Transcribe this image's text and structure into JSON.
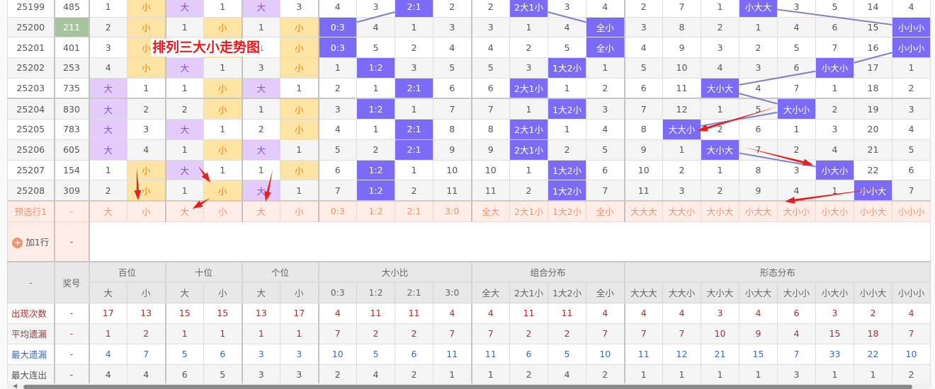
{
  "title": "排列三大小走势图",
  "colors": {
    "purple_hl": "#7b6bf6",
    "big_bg": "#e3ccfb",
    "small_bg": "#fde3a4",
    "line": "#7f7fc8",
    "arrow": "#e5211d"
  },
  "rows": [
    {
      "period": "25199",
      "number": "485",
      "cells": [
        "1",
        "小",
        "大",
        "1",
        "大",
        "3",
        "4",
        "3",
        "2:1",
        "2",
        "2",
        "2大1小",
        "3",
        "4",
        "2",
        "7",
        "1",
        "小大大",
        "3",
        "5",
        "14",
        "4"
      ]
    },
    {
      "period": "25200",
      "number": "211",
      "number_highlight": true,
      "cells": [
        "2",
        "小",
        "1",
        "小",
        "1",
        "小",
        "0:3",
        "4",
        "1",
        "3",
        "3",
        "1",
        "4",
        "全小",
        "3",
        "8",
        "2",
        "1",
        "4",
        "6",
        "15",
        "小小小"
      ]
    },
    {
      "period": "25201",
      "number": "401",
      "cells": [
        "3",
        "小",
        "2",
        "小",
        "1",
        "小",
        "0:3",
        "5",
        "2",
        "4",
        "4",
        "2",
        "5",
        "全小",
        "4",
        "9",
        "3",
        "2",
        "5",
        "7",
        "16",
        "小小小"
      ]
    },
    {
      "period": "25202",
      "number": "253",
      "cells": [
        "4",
        "小",
        "大",
        "1",
        "3",
        "小",
        "1",
        "1:2",
        "3",
        "5",
        "5",
        "3",
        "1大2小",
        "1",
        "5",
        "10",
        "4",
        "3",
        "6",
        "小大小",
        "17",
        "1"
      ]
    },
    {
      "period": "25203",
      "number": "735",
      "cells": [
        "大",
        "1",
        "1",
        "小",
        "大",
        "1",
        "2",
        "1",
        "2:1",
        "6",
        "6",
        "2大1小",
        "1",
        "2",
        "6",
        "11",
        "大小大",
        "4",
        "7",
        "1",
        "18",
        "2"
      ]
    },
    {
      "period": "25204",
      "number": "830",
      "cells": [
        "大",
        "2",
        "2",
        "小",
        "1",
        "小",
        "3",
        "1:2",
        "1",
        "7",
        "7",
        "1",
        "1大2小",
        "3",
        "7",
        "12",
        "1",
        "5",
        "大小小",
        "2",
        "19",
        "3"
      ]
    },
    {
      "period": "25205",
      "number": "783",
      "cells": [
        "大",
        "3",
        "大",
        "1",
        "2",
        "小",
        "4",
        "1",
        "2:1",
        "8",
        "8",
        "2大1小",
        "1",
        "4",
        "8",
        "大大小",
        "2",
        "6",
        "1",
        "3",
        "20",
        "4"
      ]
    },
    {
      "period": "25206",
      "number": "605",
      "cells": [
        "大",
        "4",
        "1",
        "小",
        "大",
        "1",
        "5",
        "2",
        "2:1",
        "9",
        "9",
        "2大1小",
        "2",
        "5",
        "9",
        "1",
        "大小大",
        "7",
        "2",
        "4",
        "21",
        "5"
      ]
    },
    {
      "period": "25207",
      "number": "154",
      "cells": [
        "1",
        "小",
        "大",
        "1",
        "1",
        "小",
        "6",
        "1:2",
        "1",
        "10",
        "10",
        "1",
        "1大2小",
        "6",
        "10",
        "2",
        "1",
        "8",
        "3",
        "小大小",
        "22",
        "6"
      ]
    },
    {
      "period": "25208",
      "number": "309",
      "cells": [
        "2",
        "小",
        "1",
        "小",
        "大",
        "1",
        "7",
        "1:2",
        "2",
        "11",
        "11",
        "2",
        "1大2小",
        "7",
        "11",
        "3",
        "2",
        "9",
        "4",
        "1",
        "小小大",
        "7"
      ]
    }
  ],
  "preselect": {
    "label": "预选行1",
    "number": "-",
    "cells": [
      "大",
      "小",
      "大",
      "小",
      "大",
      "小",
      "0:3",
      "1:2",
      "2:1",
      "3:0",
      "全大",
      "2大1小",
      "1大2小",
      "全小",
      "大大大",
      "大大小",
      "大小大",
      "小大大",
      "大小小",
      "小大小",
      "小小大",
      "小小小"
    ]
  },
  "add_row": {
    "label": "加1行",
    "number": "-"
  },
  "header": {
    "corner": "-",
    "number": "奖号",
    "groups": [
      "百位",
      "十位",
      "个位",
      "大小比",
      "组合分布",
      "形态分布"
    ],
    "sub": [
      "大",
      "小",
      "大",
      "小",
      "大",
      "小",
      "0:3",
      "1:2",
      "2:1",
      "3:0",
      "全大",
      "2大1小",
      "1大2小",
      "全小",
      "大大大",
      "大大小",
      "大小大",
      "小大大",
      "大小小",
      "小大小",
      "小小大",
      "小小小"
    ]
  },
  "stats": [
    {
      "label": "出现次数",
      "number": "-",
      "values": [
        "17",
        "13",
        "15",
        "15",
        "13",
        "17",
        "4",
        "11",
        "11",
        "4",
        "4",
        "11",
        "11",
        "4",
        "4",
        "4",
        "3",
        "4",
        "6",
        "3",
        "2",
        "4"
      ]
    },
    {
      "label": "平均遗漏",
      "number": "-",
      "values": [
        "1",
        "2",
        "1",
        "1",
        "1",
        "1",
        "7",
        "2",
        "2",
        "7",
        "7",
        "2",
        "2",
        "7",
        "7",
        "7",
        "10",
        "9",
        "4",
        "15",
        "18",
        "7"
      ]
    },
    {
      "label": "最大遗漏",
      "number": "-",
      "values": [
        "4",
        "7",
        "5",
        "6",
        "3",
        "3",
        "10",
        "5",
        "6",
        "11",
        "11",
        "6",
        "5",
        "10",
        "11",
        "12",
        "21",
        "15",
        "7",
        "33",
        "22",
        "10"
      ]
    },
    {
      "label": "最大连出",
      "number": "-",
      "values": [
        "4",
        "4",
        "6",
        "5",
        "3",
        "3",
        "2",
        "4",
        "2",
        "1",
        "1",
        "2",
        "4",
        "2",
        "1",
        "1",
        "1",
        "1",
        "3",
        "1",
        "1",
        "2"
      ]
    }
  ]
}
